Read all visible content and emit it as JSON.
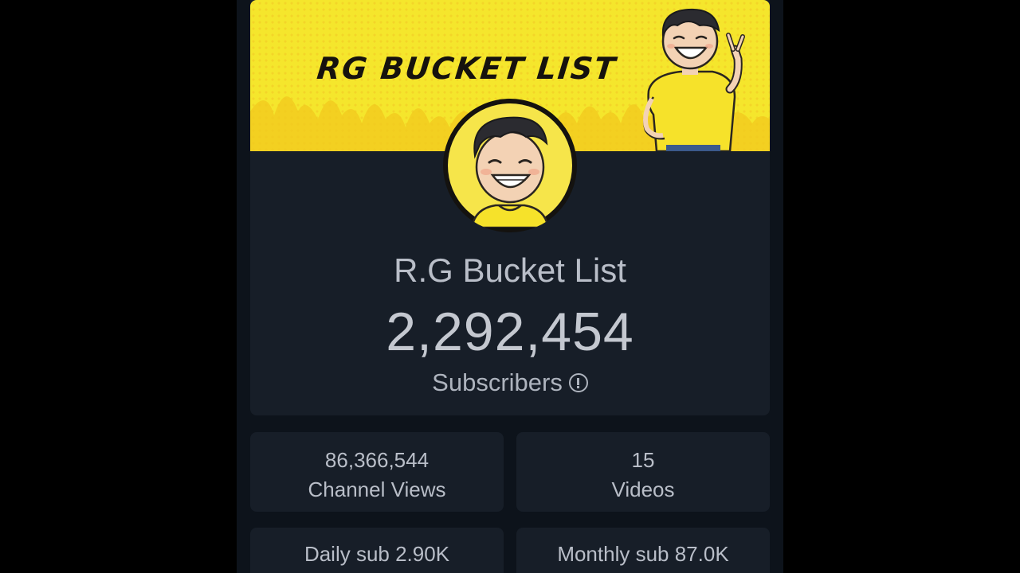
{
  "banner": {
    "title": "RG BUCKET LIST",
    "colors": {
      "background": "#f5e62c",
      "title": "#16120e"
    }
  },
  "channel": {
    "name": "R.G Bucket List",
    "subscriber_count": "2,292,454",
    "subscriber_label": "Subscribers",
    "info_icon": "info-circle-icon"
  },
  "stats": {
    "channel_views": {
      "value": "86,366,544",
      "label": "Channel Views"
    },
    "videos": {
      "value": "15",
      "label": "Videos"
    },
    "daily_sub": "Daily sub 2.90K",
    "monthly_sub": "Monthly sub 87.0K"
  },
  "theme": {
    "page_background": "#000000",
    "app_background": "#0d131b",
    "card_background": "#171e28",
    "text_color": "#b9bec8"
  }
}
